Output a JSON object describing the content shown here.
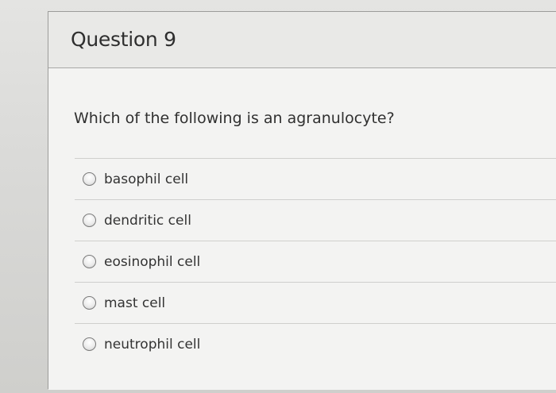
{
  "question": {
    "title": "Question 9",
    "text": "Which of the following is an agranulocyte?",
    "options": [
      {
        "label": "basophil cell"
      },
      {
        "label": "dendritic cell"
      },
      {
        "label": "eosinophil cell"
      },
      {
        "label": "mast cell"
      },
      {
        "label": "neutrophil cell"
      }
    ]
  }
}
